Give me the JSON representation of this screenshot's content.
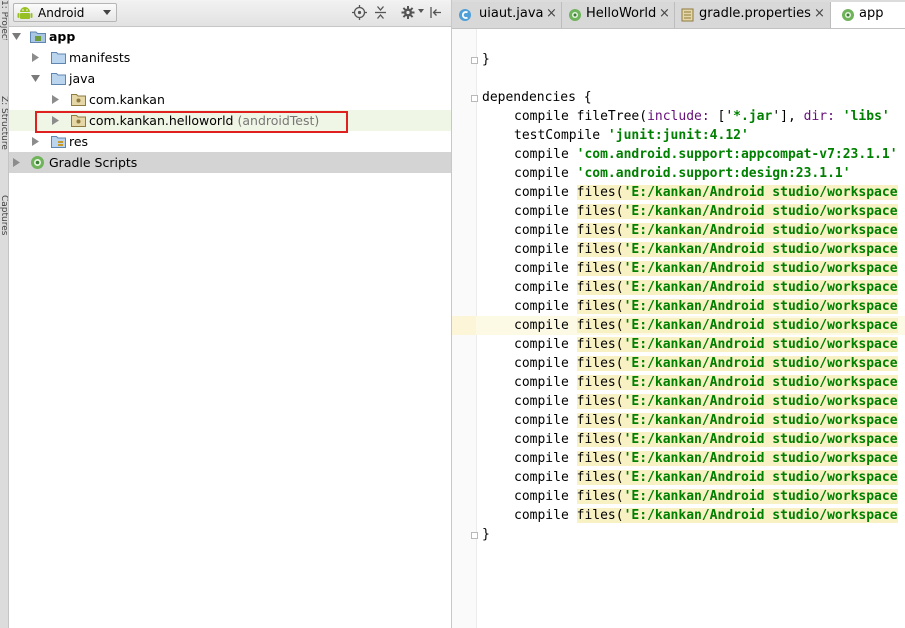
{
  "tool_strip": {
    "tabs": [
      "1: Project",
      "Z: Structure",
      "Captures"
    ]
  },
  "project_panel": {
    "view_selector": "Android",
    "tree": [
      {
        "label": "app",
        "level": 0,
        "expanded": true,
        "bold": true,
        "icon": "module-icon"
      },
      {
        "label": "manifests",
        "level": 1,
        "expanded": false,
        "icon": "folder-icon"
      },
      {
        "label": "java",
        "level": 1,
        "expanded": true,
        "icon": "folder-icon"
      },
      {
        "label": "com.kankan",
        "level": 2,
        "expanded": false,
        "icon": "package-icon"
      },
      {
        "label": "com.kankan.helloworld",
        "suffix": "(androidTest)",
        "level": 2,
        "expanded": false,
        "icon": "package-icon"
      },
      {
        "label": "res",
        "level": 1,
        "expanded": false,
        "icon": "res-folder-icon"
      },
      {
        "label": "Gradle Scripts",
        "level": 0,
        "expanded": false,
        "icon": "gradle-icon"
      }
    ]
  },
  "editor": {
    "tabs": [
      {
        "label": "uiaut.java",
        "icon": "java-class-icon",
        "active": false
      },
      {
        "label": "HelloWorld",
        "icon": "gradle-icon",
        "active": false
      },
      {
        "label": "gradle.properties",
        "icon": "properties-icon",
        "active": false
      },
      {
        "label": "app",
        "icon": "gradle-icon",
        "active": true
      }
    ],
    "code": {
      "close_brace": "}",
      "dependencies_open": "dependencies {",
      "filetree_prefix": "compile fileTree(",
      "filetree_include": "include:",
      "filetree_mid1": " ['",
      "filetree_jar": "*.jar",
      "filetree_mid2": "'], ",
      "filetree_dir": "dir:",
      "filetree_libs": " 'libs'",
      "test_compile": "testCompile ",
      "junit": "'junit:junit:4.12'",
      "compile": "compile ",
      "appcompat": "'com.android.support:appcompat-v7:23.1.1'",
      "design": "'com.android.support:design:23.1.1'",
      "files_call": "files(",
      "files_path": "'E:/kankan/Android studio/workspace",
      "files_count": 18,
      "end_brace": "}"
    },
    "colors": {
      "keyword": "#000080",
      "string": "#008000",
      "param": "#660e7a",
      "highlight": "#f7f1c4",
      "annotation": "#e0201f"
    }
  }
}
